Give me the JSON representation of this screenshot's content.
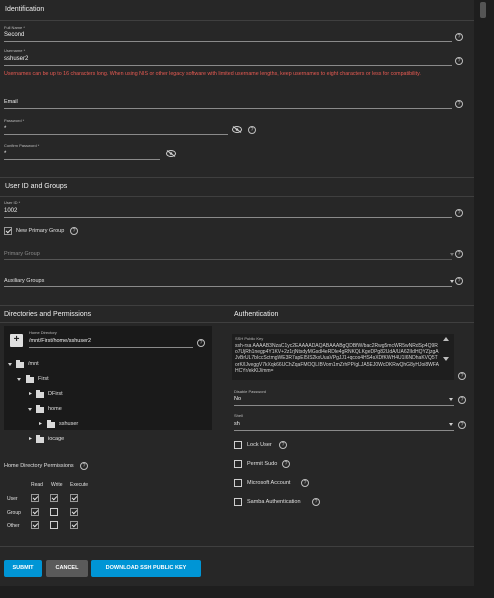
{
  "identification": {
    "title": "Identification",
    "full_name_label": "Full Name *",
    "full_name_value": "Second",
    "username_label": "Username *",
    "username_value": "sshuser2",
    "username_warning": "Usernames can be up to 16 characters long. When using NIS or other legacy software with limited username lengths, keep usernames to eight characters or less for compatibility.",
    "email_label": "Email",
    "password_label": "Password *",
    "password_value": "*",
    "confirm_password_label": "Confirm Password *",
    "confirm_password_value": "*"
  },
  "userid_groups": {
    "title": "User ID and Groups",
    "user_id_label": "User ID *",
    "user_id_value": "1002",
    "new_primary_group_label": "New Primary Group",
    "new_primary_group_checked": true,
    "primary_group_placeholder": "Primary Group",
    "auxiliary_groups_placeholder": "Auxiliary Groups"
  },
  "directories": {
    "title": "Directories and Permissions",
    "home_directory_label": "Home Directory",
    "home_directory_value": "/mnt/First/home/sshuser2",
    "tree": {
      "mnt": "/mnt",
      "first": "First",
      "dfirst": "DFirst",
      "home": "home",
      "sshuser": "sshuser",
      "iocage": "iocage"
    },
    "permissions_title": "Home Directory Permissions",
    "columns": [
      "Read",
      "Write",
      "Execute"
    ],
    "rows": [
      {
        "name": "User",
        "read": true,
        "write": true,
        "execute": true
      },
      {
        "name": "Group",
        "read": true,
        "write": false,
        "execute": true
      },
      {
        "name": "Other",
        "read": true,
        "write": false,
        "execute": true
      }
    ]
  },
  "authentication": {
    "title": "Authentication",
    "ssh_key_label": "SSH Public Key",
    "ssh_key_value": "ssh-rsa AAAAB3NzaC1yc2EAAAADAQABAAABgQDBfW/bac2Rwg5mcWR5wNRdSp4Q9Ro7UjRh1negp4Y1KV+2z1rjNtsdyMGsdl4eRDle4gRNKQLKgeDPg82UdA/UA62IIdHQYZjzgA JvBrUL7bIccSctmgWE3R7apEI5IS2kxUuaVPgJJ1+qcos4HS4sXDfKWH4U1I6NDhaKVQ5TorK/IJveggV7kXqk66UChZqaFMOQLIBVom1mZrhPP/gLJA5EJ0WcDKRwQhG8yHJoi8WFAHCYr/ekKlJ/mm="
  },
  "disable_password": {
    "label": "Disable Password",
    "value": "No"
  },
  "shell": {
    "label": "Shell",
    "value": "sh"
  },
  "options": {
    "lock_user": "Lock User",
    "permit_sudo": "Permit Sudo",
    "microsoft_account": "Microsoft Account",
    "samba_auth": "Samba Authentication"
  },
  "buttons": {
    "submit": "SUBMIT",
    "cancel": "CANCEL",
    "download": "DOWNLOAD SSH PUBLIC KEY"
  },
  "icons": {
    "help": "?",
    "eye_off": "eye-off-icon",
    "add_folder": "+",
    "folder": "folder-icon"
  },
  "colors": {
    "accent": "#0095d5",
    "error": "#e85a52",
    "cancel": "#5a5a5a"
  }
}
